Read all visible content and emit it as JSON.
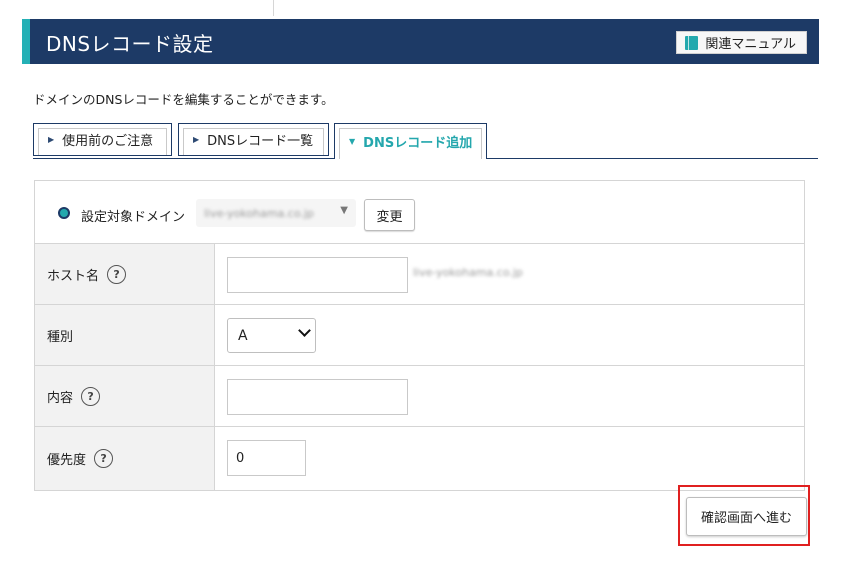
{
  "header": {
    "title": "DNSレコード設定",
    "manual_button": "関連マニュアル",
    "manual_icon": "book-icon",
    "accent_color": "#1d3a66",
    "stripe_color": "#24b0b5"
  },
  "description": "ドメインのDNSレコードを編集することができます。",
  "tabs": [
    {
      "label": "使用前のご注意",
      "active": false
    },
    {
      "label": "DNSレコード一覧",
      "active": false
    },
    {
      "label": "DNSレコード追加",
      "active": true
    }
  ],
  "domain_selector": {
    "label": "設定対象ドメイン",
    "selected": "live-yokohama.co.jp",
    "change_button": "変更"
  },
  "form": {
    "rows": [
      {
        "label": "ホスト名",
        "help": "?",
        "value": "",
        "suffix": "live-yokohama.co.jp"
      },
      {
        "label": "種別",
        "value": "A"
      },
      {
        "label": "内容",
        "help": "?",
        "value": ""
      },
      {
        "label": "優先度",
        "help": "?",
        "value": "0"
      }
    ]
  },
  "confirm_button": "確認画面へ進む"
}
